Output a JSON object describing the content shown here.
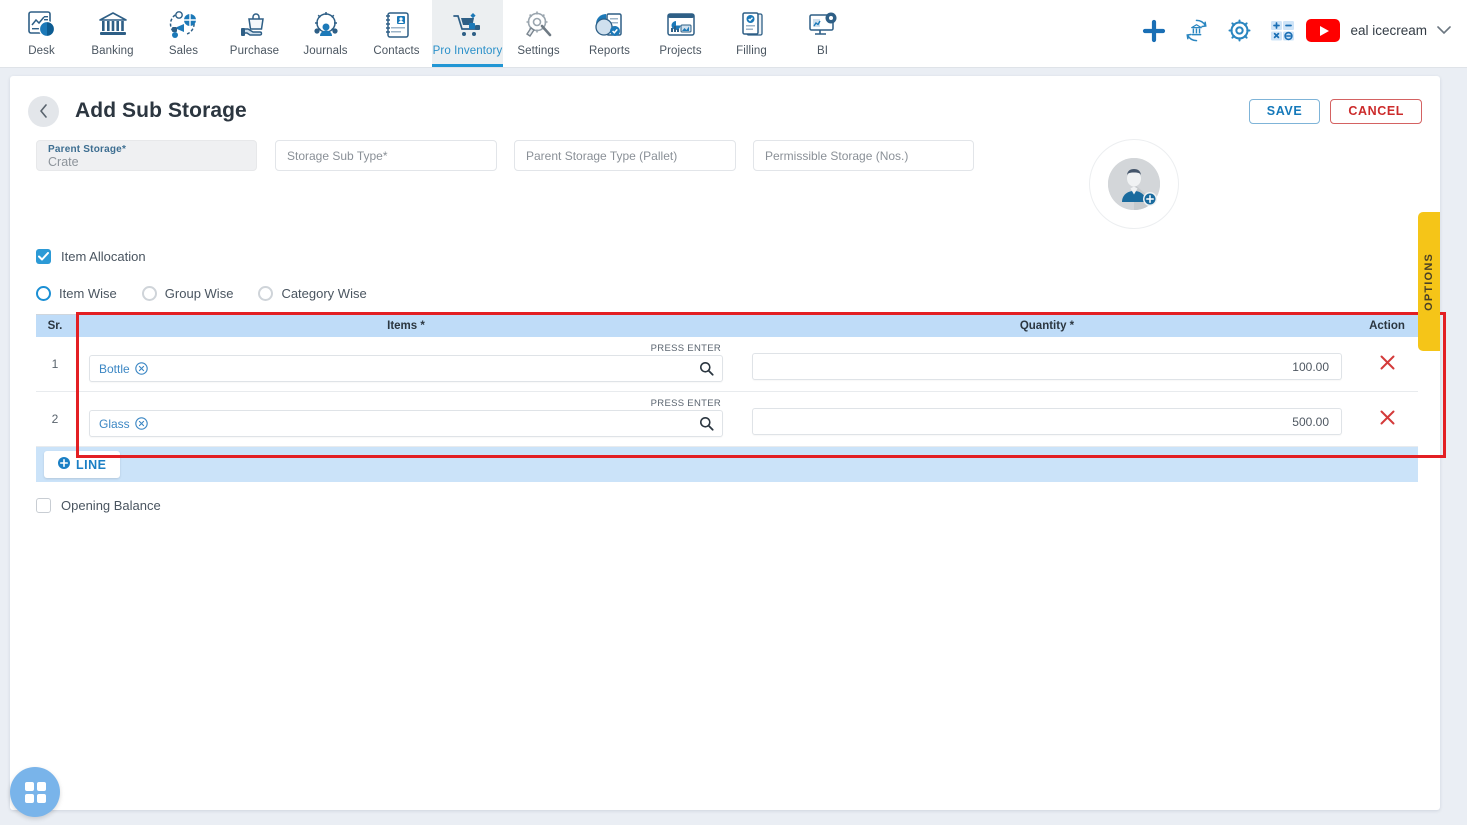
{
  "topnav": {
    "items": [
      {
        "label": "Desk",
        "icon": "desk-chart-icon",
        "active": false
      },
      {
        "label": "Banking",
        "icon": "bank-icon",
        "active": false
      },
      {
        "label": "Sales",
        "icon": "sales-megaphone-icon",
        "active": false
      },
      {
        "label": "Purchase",
        "icon": "purchase-bag-hand-icon",
        "active": false
      },
      {
        "label": "Journals",
        "icon": "journals-gear-people-icon",
        "active": false
      },
      {
        "label": "Contacts",
        "icon": "contacts-card-icon",
        "active": false
      },
      {
        "label": "Pro Inventory",
        "icon": "inventory-cart-icon",
        "active": true
      },
      {
        "label": "Settings",
        "icon": "settings-tools-icon",
        "active": false
      },
      {
        "label": "Reports",
        "icon": "reports-piechart-icon",
        "active": false
      },
      {
        "label": "Projects",
        "icon": "projects-dashboard-icon",
        "active": false
      },
      {
        "label": "Filling",
        "icon": "filling-documents-icon",
        "active": false
      },
      {
        "label": "BI",
        "icon": "bi-monitor-icon",
        "active": false
      }
    ],
    "right": {
      "add_icon": "plus-icon",
      "bank_sync_icon": "bank-refresh-icon",
      "settings_icon": "gear-icon",
      "calculator_icon": "calculator-icon",
      "youtube_icon": "youtube-icon",
      "user_name": "eal icecream",
      "chevron_icon": "chevron-down-icon"
    }
  },
  "header": {
    "back_icon": "chevron-left-icon",
    "title": "Add Sub Storage",
    "save_label": "SAVE",
    "cancel_label": "CANCEL"
  },
  "form": {
    "parent_storage": {
      "label": "Parent Storage",
      "required": "*",
      "value": "Crate"
    },
    "storage_sub_type": {
      "placeholder": "Storage Sub Type",
      "required": "*"
    },
    "parent_storage_type": {
      "placeholder": "Parent Storage Type (Pallet)"
    },
    "permissible_storage": {
      "placeholder": "Permissible Storage (Nos.)"
    },
    "avatar_icon": "avatar-upload-icon"
  },
  "allocation": {
    "checkbox_label": "Item Allocation",
    "checkbox_checked": true,
    "radios": [
      {
        "label": "Item Wise",
        "selected": true
      },
      {
        "label": "Group Wise",
        "selected": false
      },
      {
        "label": "Category Wise",
        "selected": false
      }
    ]
  },
  "table": {
    "columns": [
      "Sr.",
      "Items",
      "Quantity",
      "Action"
    ],
    "items_required": "*",
    "quantity_required": "*",
    "press_enter_hint": "PRESS ENTER",
    "search_icon": "search-icon",
    "remove_icon": "remove-row-icon",
    "chip_close_icon": "chip-close-icon",
    "rows": [
      {
        "sr": "1",
        "item": "Bottle",
        "quantity": "100.00"
      },
      {
        "sr": "2",
        "item": "Glass",
        "quantity": "500.00"
      }
    ],
    "add_line_label": "LINE",
    "add_line_icon": "plus-circle-icon"
  },
  "opening_balance": {
    "label": "Opening Balance",
    "checked": false
  },
  "options_tab": {
    "label": "OPTIONS"
  },
  "fab": {
    "icon": "apps-grid-icon"
  },
  "colors": {
    "accent_blue": "#1b7fc4",
    "nav_active": "#2a90c9",
    "table_header": "#bfdcf8",
    "table_footer": "#cbe3f9",
    "danger_red": "#d33a3a",
    "annotation_red": "#e31f23",
    "options_yellow": "#f5c518",
    "youtube_red": "#ff0000"
  }
}
